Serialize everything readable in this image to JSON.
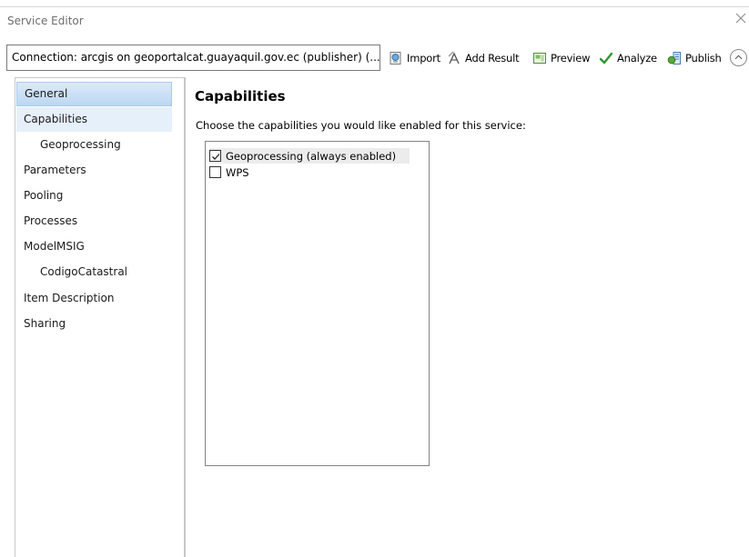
{
  "window": {
    "title": "Service Editor"
  },
  "toolbar": {
    "connection": "Connection: arcgis on geoportalcat.guayaquil.gov.ec (publisher) (...",
    "import_label": "Import",
    "add_result_label": "Add Result",
    "preview_label": "Preview",
    "analyze_label": "Analyze",
    "publish_label": "Publish"
  },
  "sidebar": {
    "items": [
      {
        "label": "General"
      },
      {
        "label": "Capabilities"
      },
      {
        "label": "Geoprocessing"
      },
      {
        "label": "Parameters"
      },
      {
        "label": "Pooling"
      },
      {
        "label": "Processes"
      },
      {
        "label": "ModelMSIG"
      },
      {
        "label": "CodigoCatastral"
      },
      {
        "label": "Item Description"
      },
      {
        "label": "Sharing"
      }
    ],
    "selected": "General"
  },
  "main": {
    "title": "Capabilities",
    "instruction": "Choose the capabilities you would like enabled for this service:",
    "capabilities": [
      {
        "label": "Geoprocessing (always enabled)",
        "checked": true
      },
      {
        "label": "WPS",
        "checked": false
      }
    ]
  },
  "colors": {
    "selection": "#bcd7f2",
    "analyze_check": "#2e9a2e",
    "border": "#c8c8c8"
  }
}
